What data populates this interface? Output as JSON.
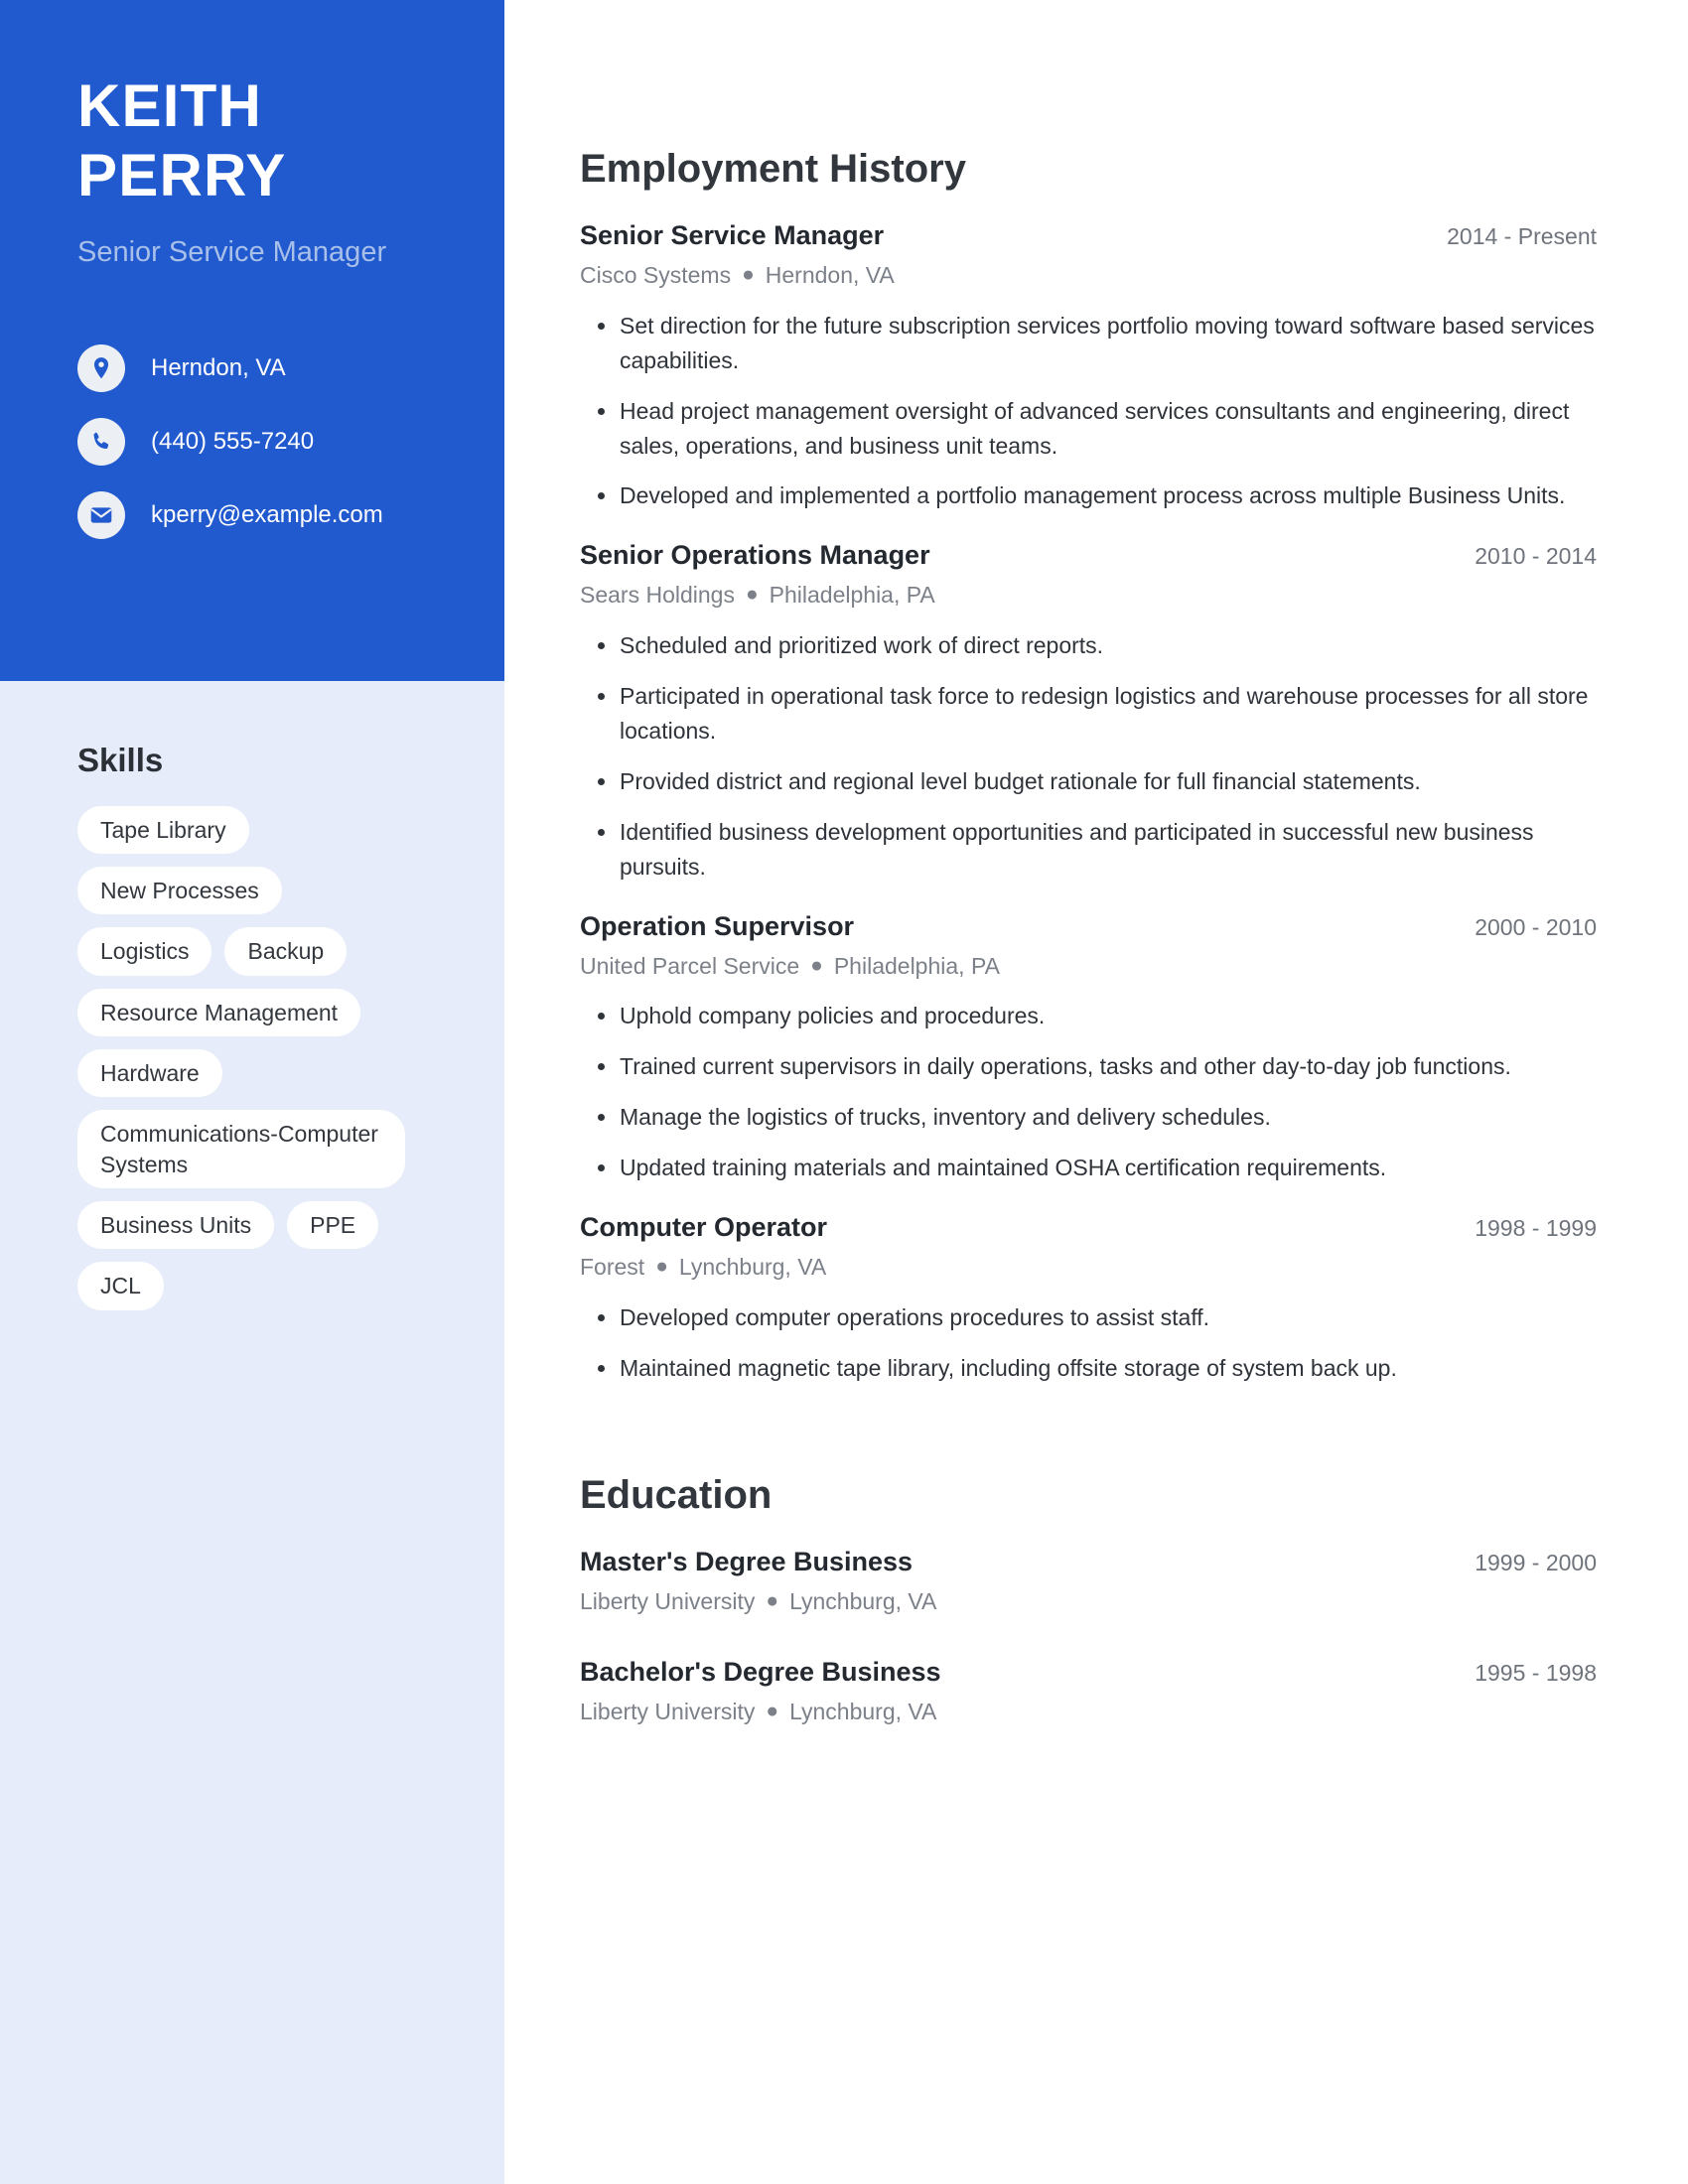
{
  "theme": {
    "accent": "#2159ce",
    "sidebar_light": "#e6ecf9",
    "subtitle": "#a8c0e9",
    "text_dark": "#2f333a",
    "text_muted": "#7c8189",
    "tag_bg": "#ffffff"
  },
  "sidebar": {
    "name_first": "KEITH",
    "name_last": "PERRY",
    "job_title": "Senior Service Manager",
    "contacts": [
      {
        "icon": "location-pin-icon",
        "value": "Herndon, VA"
      },
      {
        "icon": "phone-icon",
        "value": "(440) 555-7240"
      },
      {
        "icon": "envelope-icon",
        "value": "kperry@example.com"
      }
    ],
    "skills_heading": "Skills",
    "skills": [
      "Tape Library",
      "New Processes",
      "Logistics",
      "Backup",
      "Resource Management",
      "Hardware",
      "Communications-Computer Systems",
      "Business Units",
      "PPE",
      "JCL"
    ]
  },
  "main": {
    "employment_heading": "Employment History",
    "education_heading": "Education",
    "jobs": [
      {
        "role": "Senior Service Manager",
        "dates": "2014 - Present",
        "company": "Cisco Systems",
        "location": "Herndon, VA",
        "bullets": [
          "Set direction for the future subscription services portfolio moving toward software based services capabilities.",
          "Head project management oversight of advanced services consultants and engineering, direct sales, operations, and business unit teams.",
          "Developed and implemented a portfolio management process across multiple Business Units."
        ]
      },
      {
        "role": "Senior Operations Manager",
        "dates": "2010 - 2014",
        "company": "Sears Holdings",
        "location": "Philadelphia, PA",
        "bullets": [
          "Scheduled and prioritized work of direct reports.",
          "Participated in operational task force to redesign logistics and warehouse processes for all store locations.",
          "Provided district and regional level budget rationale for full financial statements.",
          "Identified business development opportunities and participated in successful new business pursuits."
        ]
      },
      {
        "role": "Operation Supervisor",
        "dates": "2000 - 2010",
        "company": "United Parcel Service",
        "location": "Philadelphia, PA",
        "bullets": [
          "Uphold company policies and procedures.",
          "Trained current supervisors in daily operations, tasks and other day-to-day job functions.",
          "Manage the logistics of trucks, inventory and delivery schedules.",
          "Updated training materials and maintained OSHA certification requirements."
        ]
      },
      {
        "role": "Computer Operator",
        "dates": "1998 - 1999",
        "company": "Forest",
        "location": "Lynchburg, VA",
        "bullets": [
          "Developed computer operations procedures to assist staff.",
          "Maintained magnetic tape library, including offsite storage of system back up."
        ]
      }
    ],
    "education": [
      {
        "degree": "Master's Degree Business",
        "dates": "1999 - 2000",
        "school": "Liberty University",
        "location": "Lynchburg, VA"
      },
      {
        "degree": "Bachelor's Degree Business",
        "dates": "1995 - 1998",
        "school": "Liberty University",
        "location": "Lynchburg, VA"
      }
    ]
  }
}
